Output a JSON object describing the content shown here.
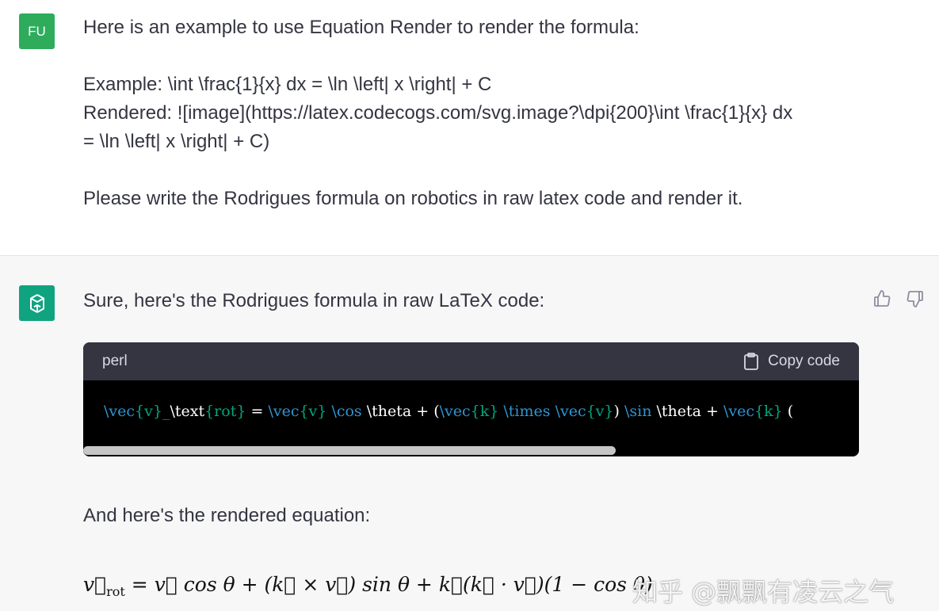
{
  "user_message": {
    "avatar_initials": "FU",
    "lines": [
      "Here is an example to use Equation Render to render the formula:",
      "Example: \\int \\frac{1}{x} dx = \\ln \\left| x \\right| + C",
      "Rendered: ![image](https://latex.codecogs.com/svg.image?\\dpi{200}\\int \\frac{1}{x} dx",
      "= \\ln \\left| x \\right| + C)",
      "Please write the Rodrigues formula on robotics in raw latex code and render it."
    ]
  },
  "assistant_message": {
    "intro": "Sure, here's the Rodrigues formula in raw LaTeX code:",
    "code_block": {
      "language": "perl",
      "copy_label": "Copy code",
      "code": "\\vec{v}_\\text{rot} = \\vec{v} \\cos \\theta + (\\vec{k} \\times \\vec{v}) \\sin \\theta + \\vec{k} ("
    },
    "rendered_intro": "And here's the rendered equation:",
    "rendered_equation": "v⃗rot = v⃗ cos θ + (k⃗ × v⃗) sin θ + k⃗(k⃗ · v⃗)(1 − cos θ)"
  },
  "watermark": "知乎 @飘飘有凌云之气",
  "colors": {
    "user_avatar": "#2eac5c",
    "assistant_avatar": "#10a37f",
    "code_header": "#343541",
    "code_bg": "#000000",
    "keyword": "#2e95d3",
    "argument": "#00a67d"
  },
  "icons": {
    "assistant_logo": "openai-logo-icon",
    "thumbs_up": "thumbs-up-icon",
    "thumbs_down": "thumbs-down-icon",
    "clipboard": "clipboard-icon"
  }
}
